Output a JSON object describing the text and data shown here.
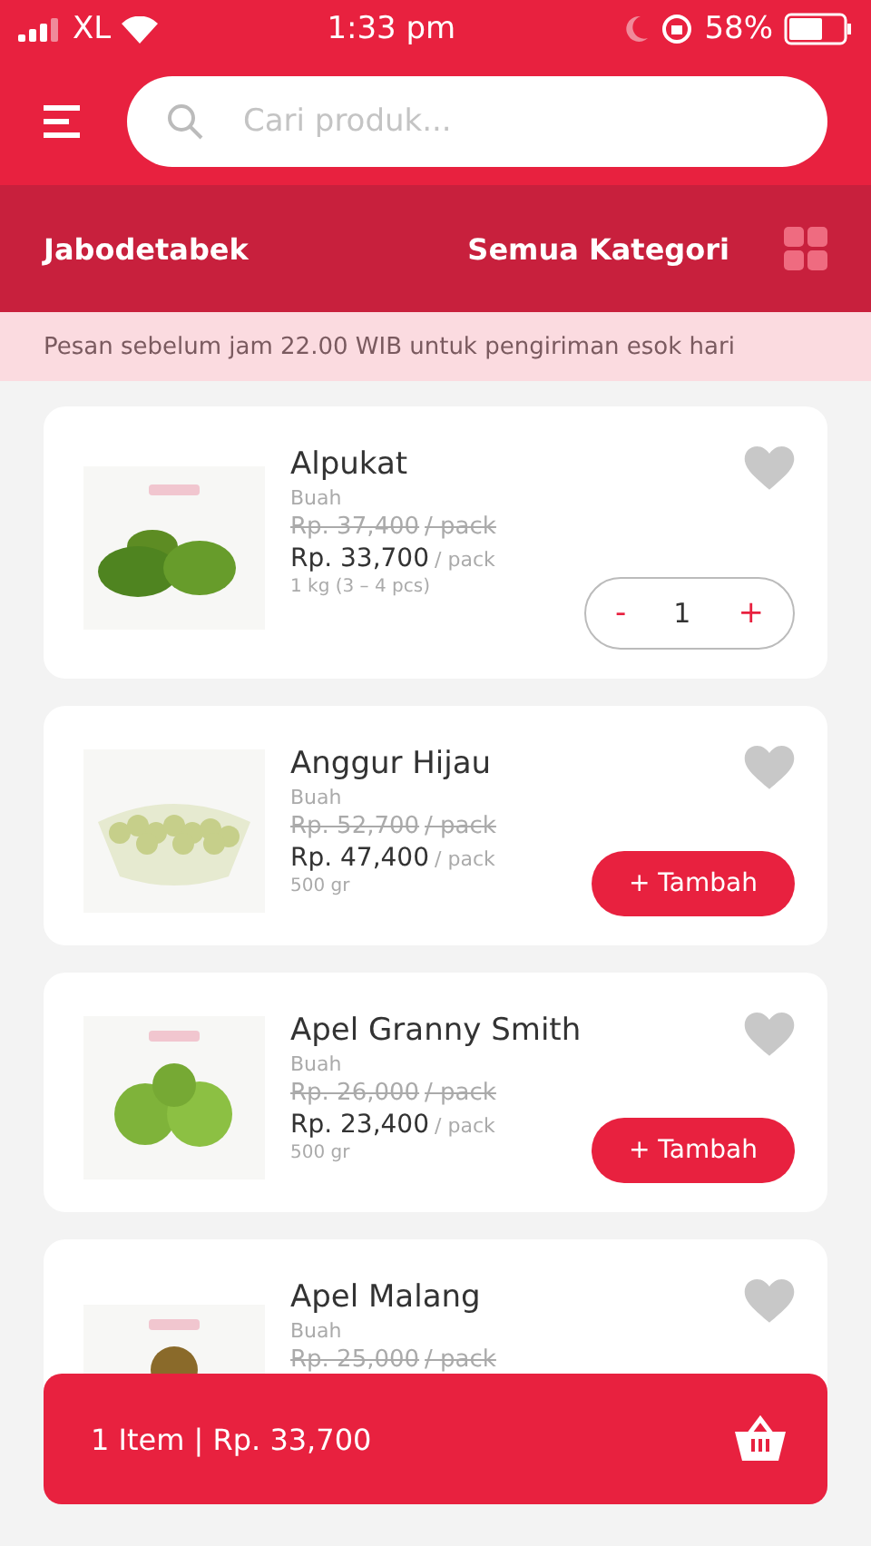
{
  "status_bar": {
    "carrier": "XL",
    "time": "1:33 pm",
    "battery": "58%"
  },
  "search": {
    "placeholder": "Cari produk..."
  },
  "region_bar": {
    "region": "Jabodetabek",
    "category": "Semua Kategori"
  },
  "notice": "Pesan sebelum jam 22.00 WIB untuk pengiriman esok hari",
  "products": [
    {
      "name": "Alpukat",
      "category": "Buah",
      "old_price": "Rp. 37,400",
      "old_unit": "/ pack",
      "price": "Rp. 33,700",
      "unit": "/ pack",
      "size": "1 kg (3 – 4 pcs)",
      "action": {
        "kind": "stepper",
        "minus": "-",
        "value": "1",
        "plus": "+"
      }
    },
    {
      "name": "Anggur Hijau",
      "category": "Buah",
      "old_price": "Rp. 52,700",
      "old_unit": "/ pack",
      "price": "Rp. 47,400",
      "unit": "/ pack",
      "size": "500 gr",
      "action": {
        "kind": "add",
        "label": "+ Tambah"
      }
    },
    {
      "name": "Apel Granny Smith",
      "category": "Buah",
      "old_price": "Rp. 26,000",
      "old_unit": "/ pack",
      "price": "Rp. 23,400",
      "unit": "/ pack",
      "size": "500 gr",
      "action": {
        "kind": "add",
        "label": "+ Tambah"
      }
    },
    {
      "name": "Apel Malang",
      "category": "Buah",
      "old_price": "Rp. 25,000",
      "old_unit": "/ pack"
    }
  ],
  "cart_bar": {
    "summary": "1 Item | Rp. 33,700"
  }
}
